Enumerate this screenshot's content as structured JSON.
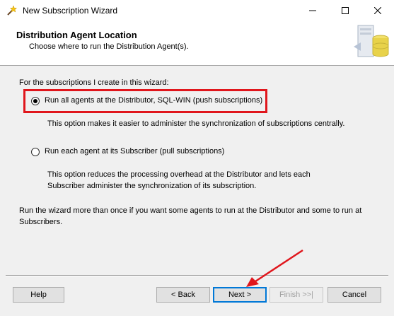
{
  "window": {
    "title": "New Subscription Wizard"
  },
  "header": {
    "title": "Distribution Agent Location",
    "subtitle": "Choose where to run the Distribution Agent(s)."
  },
  "body": {
    "intro": "For the subscriptions I create in this wizard:",
    "options": [
      {
        "label": "Run all agents at the Distributor, SQL-WIN (push subscriptions)",
        "selected": true,
        "description": "This option makes it easier to administer the synchronization of subscriptions centrally."
      },
      {
        "label": "Run each agent at its Subscriber (pull subscriptions)",
        "selected": false,
        "description_line1": "This option reduces the processing overhead at the Distributor and lets each",
        "description_line2": "Subscriber administer the synchronization of its subscription."
      }
    ],
    "note_line1": "Run the wizard more than once if you want some agents to run at the Distributor and some to run at",
    "note_line2": "Subscribers."
  },
  "buttons": {
    "help": "Help",
    "back": "< Back",
    "next": "Next >",
    "finish": "Finish >>|",
    "cancel": "Cancel"
  },
  "colors": {
    "highlight": "#e0161c",
    "accent": "#0078d7"
  }
}
